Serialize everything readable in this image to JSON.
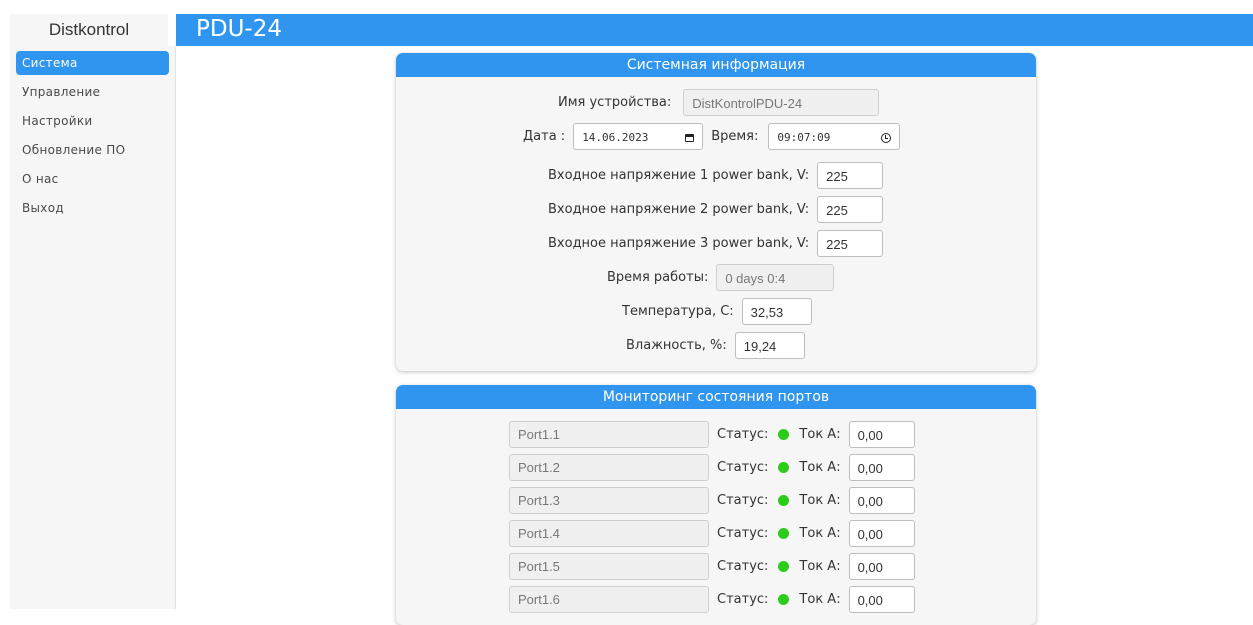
{
  "brand": {
    "name": "Distkontrol"
  },
  "header": {
    "title": "PDU-24"
  },
  "sidebar": {
    "items": [
      {
        "label": "Система",
        "active": true
      },
      {
        "label": "Управление"
      },
      {
        "label": "Настройки"
      },
      {
        "label": "Обновление ПО"
      },
      {
        "label": "О нас"
      },
      {
        "label": "Выход"
      }
    ]
  },
  "system_info": {
    "title": "Системная информация",
    "device_name_label": "Имя устройства:",
    "device_name_value": "DistKontrolPDU-24",
    "date_label": "Дата :",
    "date_value": "14.06.2023",
    "time_label": "Время:",
    "time_value": "09:07:09",
    "voltage1_label": "Входное напряжение 1 power bank, V:",
    "voltage1_value": "225",
    "voltage2_label": "Входное напряжение 2 power bank, V:",
    "voltage2_value": "225",
    "voltage3_label": "Входное напряжение 3 power bank, V:",
    "voltage3_value": "225",
    "uptime_label": "Время работы:",
    "uptime_value": "0 days 0:4",
    "temperature_label": "Температура, С:",
    "temperature_value": "32,53",
    "humidity_label": "Влажность, %:",
    "humidity_value": "19,24"
  },
  "ports": {
    "title": "Мониторинг состояния портов",
    "status_label": "Статус:",
    "current_label": "Ток А:",
    "status_color": "#2ecc1a",
    "items": [
      {
        "name": "Port1.1",
        "current": "0,00"
      },
      {
        "name": "Port1.2",
        "current": "0,00"
      },
      {
        "name": "Port1.3",
        "current": "0,00"
      },
      {
        "name": "Port1.4",
        "current": "0,00"
      },
      {
        "name": "Port1.5",
        "current": "0,00"
      },
      {
        "name": "Port1.6",
        "current": "0,00"
      }
    ]
  },
  "colors": {
    "accent": "#2f95ee",
    "status_ok": "#2ecc1a"
  }
}
